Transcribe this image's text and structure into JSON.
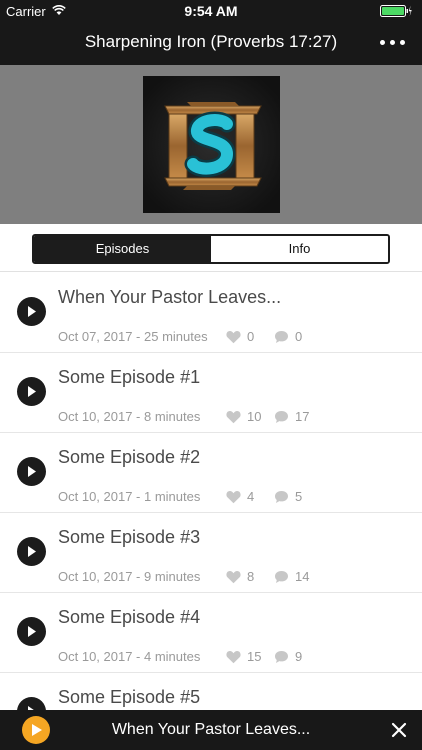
{
  "status_bar": {
    "carrier": "Carrier",
    "time": "9:54 AM"
  },
  "nav": {
    "title": "Sharpening Iron (Proverbs 17:27)",
    "more_icon": "more-dots-icon"
  },
  "tabs": [
    {
      "label": "Episodes",
      "active": true
    },
    {
      "label": "Info",
      "active": false
    }
  ],
  "episodes": [
    {
      "title": "When Your Pastor Leaves...",
      "meta": "Oct 07, 2017 - 25 minutes",
      "likes": "0",
      "comments": "0"
    },
    {
      "title": "Some Episode #1",
      "meta": "Oct 10, 2017 - 8 minutes",
      "likes": "10",
      "comments": "17"
    },
    {
      "title": "Some Episode #2",
      "meta": "Oct 10, 2017 - 1 minutes",
      "likes": "4",
      "comments": "5"
    },
    {
      "title": "Some Episode #3",
      "meta": "Oct 10, 2017 - 9 minutes",
      "likes": "8",
      "comments": "14"
    },
    {
      "title": "Some Episode #4",
      "meta": "Oct 10, 2017 - 4 minutes",
      "likes": "15",
      "comments": "9"
    },
    {
      "title": "Some Episode #5",
      "meta": "",
      "likes": "",
      "comments": ""
    }
  ],
  "mini_player": {
    "title": "When Your Pastor Leaves..."
  },
  "colors": {
    "bar": "#181818",
    "accent": "#f5a623",
    "hero_bg": "#7f7f7f",
    "logo_s": "#29c1d6",
    "logo_bronze": "#b07a3c"
  }
}
